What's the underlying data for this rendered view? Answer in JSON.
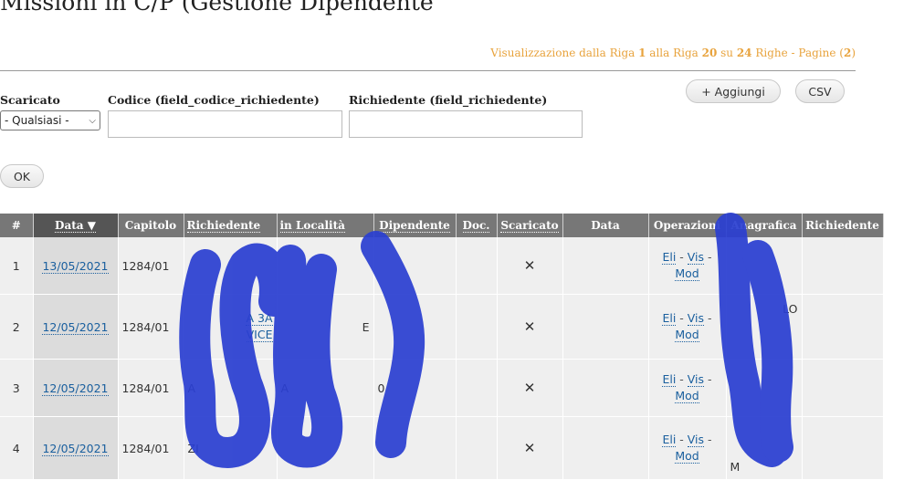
{
  "page": {
    "title": "Missioni in C/P (Gestione Dipendente"
  },
  "pager": {
    "prefix": "Visualizzazione dalla Riga ",
    "from": "1",
    "mid1": " alla Riga ",
    "to": "20",
    "mid2": " su ",
    "total": "24",
    "mid3": " Righe - Pagine (",
    "pages": "2",
    "suffix": ")"
  },
  "filters": {
    "scaricato_label": "Scaricato",
    "scaricato_value": "- Qualsiasi -",
    "codice_label": "Codice (field_codice_richiedente)",
    "richiedente_label": "Richiedente (field_richiedente)",
    "ok_label": "OK"
  },
  "toolbar": {
    "add_label": "+ Aggiungi",
    "csv_label": "CSV"
  },
  "table": {
    "headers": {
      "num": "#",
      "data": "Data ▼",
      "capitolo": "Capitolo",
      "richiedente": "Richiedente",
      "localita": "in Località",
      "dipendente": "Dipendente",
      "doc": "Doc.",
      "scaricato": "Scaricato",
      "data2": "Data",
      "operazioni": "Operazioni",
      "anagrafica": "Anagrafica",
      "richiedente2": "Richiedente"
    },
    "rows": [
      {
        "num": "1",
        "date": "13/05/2021",
        "capitolo": "1284/01",
        "richiedente": "",
        "localita": "",
        "dipendente": "",
        "scaricato": "✕",
        "anagrafica": ""
      },
      {
        "num": "2",
        "date": "12/05/2021",
        "capitolo": "1284/01",
        "richiedente": "A 3A",
        "richiedente_b": "VICE",
        "localita": "E",
        "dipendente": "",
        "scaricato": "✕",
        "anagrafica": "LO"
      },
      {
        "num": "3",
        "date": "12/05/2021",
        "capitolo": "1284/01",
        "richiedente": "A",
        "localita": "A",
        "dipendente": "0",
        "scaricato": "✕",
        "anagrafica": ""
      },
      {
        "num": "4",
        "date": "12/05/2021",
        "capitolo": "1284/01",
        "richiedente": "ZI",
        "localita": "",
        "dipendente": "",
        "scaricato": "✕",
        "anagrafica": "M"
      }
    ],
    "ops": {
      "eli": "Eli",
      "vis": "Vis",
      "mod": "Mod",
      "sep": "-"
    }
  },
  "colors": {
    "accent": "#e8a33d",
    "link": "#1a5f9e",
    "header_bg": "#777777",
    "scribble": "#2b3fd1"
  }
}
